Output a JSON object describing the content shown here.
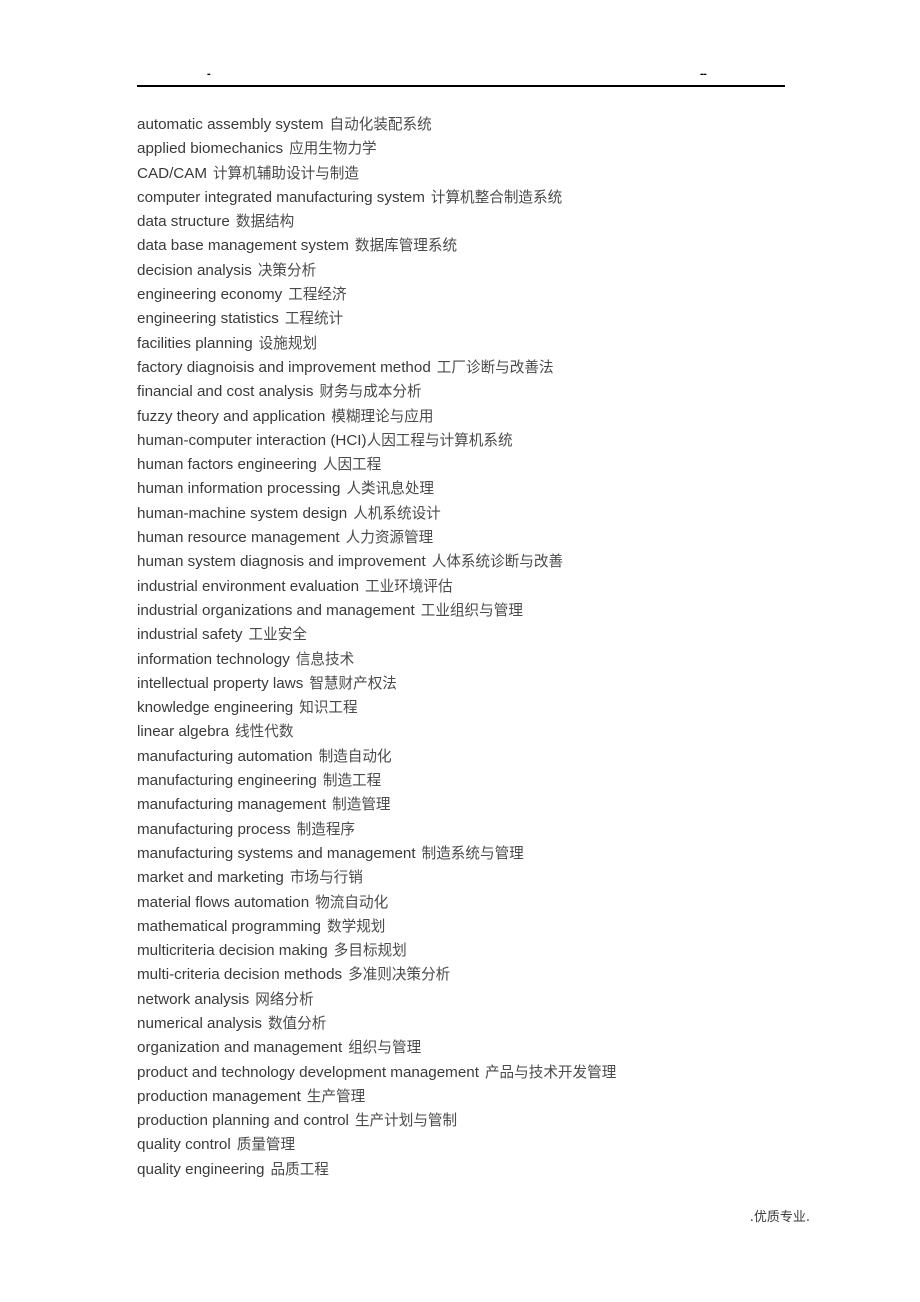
{
  "header": {
    "mark_left": "-",
    "mark_right": "--"
  },
  "footer": {
    "watermark": ".优质专业."
  },
  "glossary": {
    "entries": [
      {
        "en": "automatic assembly system",
        "zh": "自动化装配系统"
      },
      {
        "en": "applied biomechanics",
        "zh": "应用生物力学"
      },
      {
        "en": "CAD/CAM",
        "zh": "计算机辅助设计与制造"
      },
      {
        "en": "computer integrated manufacturing system",
        "zh": "计算机整合制造系统"
      },
      {
        "en": "data structure",
        "zh": "数据结构"
      },
      {
        "en": "data base management system",
        "zh": "数据库管理系统"
      },
      {
        "en": "decision analysis",
        "zh": "决策分析"
      },
      {
        "en": "engineering economy",
        "zh": "工程经济"
      },
      {
        "en": "engineering statistics",
        "zh": "工程统计"
      },
      {
        "en": "facilities planning",
        "zh": "设施规划"
      },
      {
        "en": "factory diagnoisis and improvement method",
        "zh": "工厂诊断与改善法"
      },
      {
        "en": "financial and cost analysis",
        "zh": "财务与成本分析"
      },
      {
        "en": "fuzzy theory and application",
        "zh": "模糊理论与应用"
      },
      {
        "en": "human-computer interaction (HCI)",
        "zh": "人因工程与计算机系统",
        "nogap": true
      },
      {
        "en": "human factors engineering",
        "zh": "人因工程"
      },
      {
        "en": "human information processing",
        "zh": "人类讯息处理"
      },
      {
        "en": "human-machine system design",
        "zh": "人机系统设计"
      },
      {
        "en": "human resource management",
        "zh": "人力资源管理"
      },
      {
        "en": "human system diagnosis and improvement",
        "zh": "人体系统诊断与改善"
      },
      {
        "en": "industrial environment evaluation",
        "zh": "工业环境评估"
      },
      {
        "en": "industrial organizations and management",
        "zh": "工业组织与管理"
      },
      {
        "en": "industrial safety",
        "zh": "工业安全"
      },
      {
        "en": "information technology",
        "zh": "信息技术"
      },
      {
        "en": "intellectual property laws",
        "zh": "智慧财产权法"
      },
      {
        "en": "knowledge engineering",
        "zh": "知识工程"
      },
      {
        "en": "linear algebra",
        "zh": "线性代数"
      },
      {
        "en": "manufacturing automation",
        "zh": "制造自动化"
      },
      {
        "en": "manufacturing engineering",
        "zh": "制造工程"
      },
      {
        "en": "manufacturing management",
        "zh": "制造管理"
      },
      {
        "en": "manufacturing process",
        "zh": "制造程序"
      },
      {
        "en": "manufacturing systems and management",
        "zh": "制造系统与管理"
      },
      {
        "en": "market and marketing",
        "zh": "市场与行销"
      },
      {
        "en": "material flows automation",
        "zh": "物流自动化"
      },
      {
        "en": "mathematical programming",
        "zh": "数学规划"
      },
      {
        "en": "multicriteria decision making",
        "zh": "多目标规划"
      },
      {
        "en": "multi-criteria decision methods",
        "zh": "多准则决策分析"
      },
      {
        "en": "network analysis",
        "zh": "网络分析"
      },
      {
        "en": "numerical analysis",
        "zh": "数值分析"
      },
      {
        "en": "organization and management",
        "zh": "组织与管理"
      },
      {
        "en": "product and technology development management",
        "zh": "产品与技术开发管理"
      },
      {
        "en": "production management",
        "zh": "生产管理"
      },
      {
        "en": "production planning and control",
        "zh": "生产计划与管制"
      },
      {
        "en": "quality control",
        "zh": "质量管理"
      },
      {
        "en": "quality engineering",
        "zh": "品质工程"
      }
    ]
  }
}
